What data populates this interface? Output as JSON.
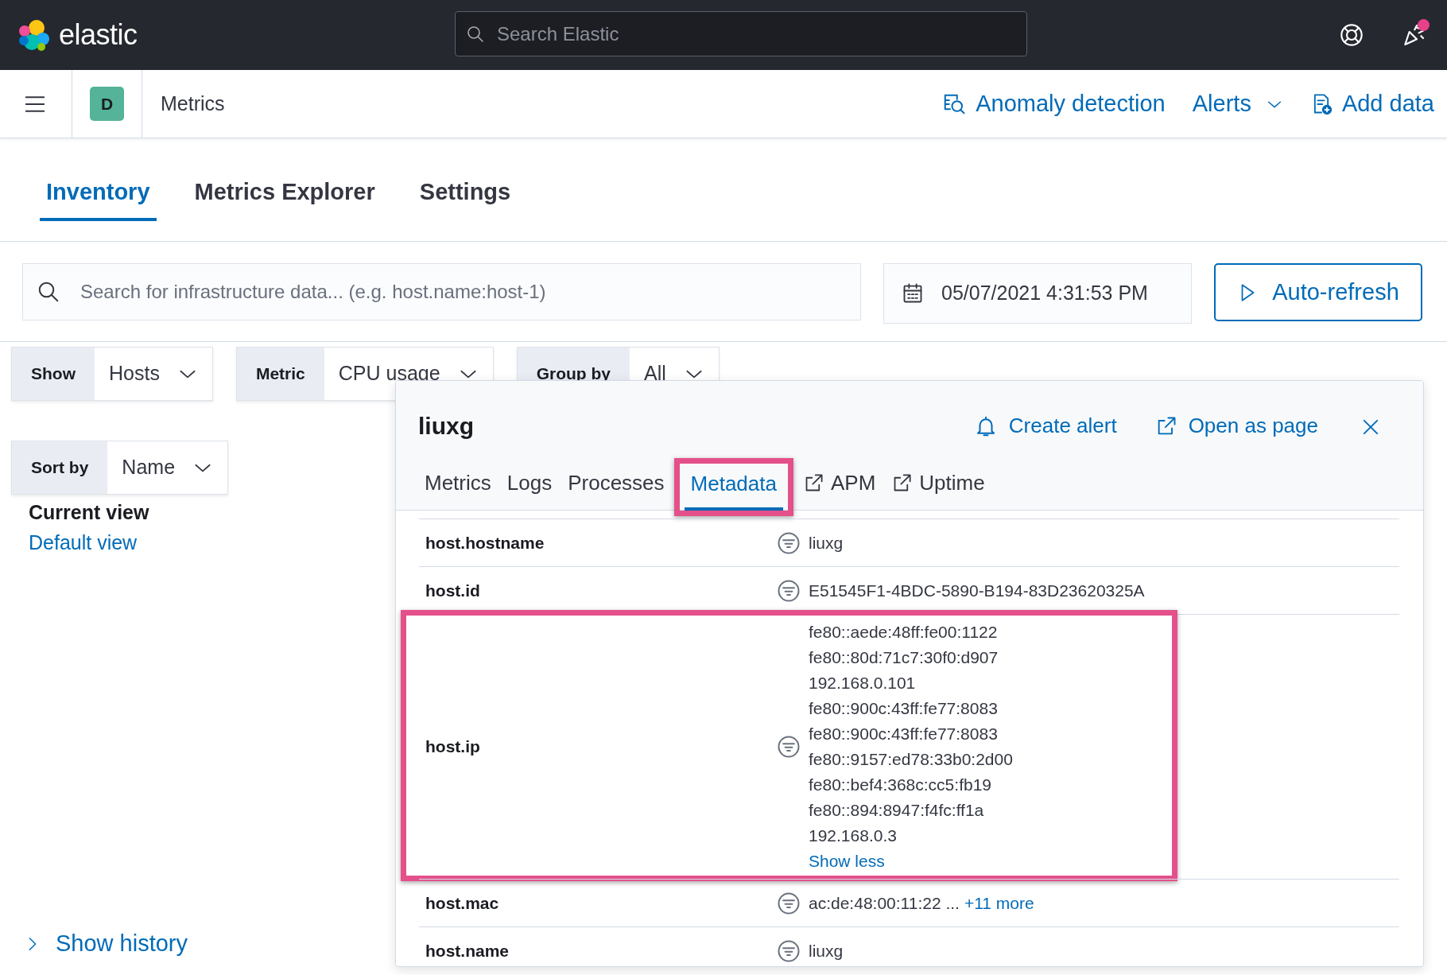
{
  "header": {
    "brand": "elastic",
    "search_placeholder": "Search Elastic",
    "notification": true
  },
  "app_bar": {
    "space_initial": "D",
    "title": "Metrics",
    "links": [
      {
        "label": "Anomaly detection",
        "kind": "anomaly"
      },
      {
        "label": "Alerts",
        "kind": "dropdown"
      },
      {
        "label": "Add data",
        "kind": "add"
      }
    ]
  },
  "tabs": [
    {
      "label": "Inventory",
      "selected": true
    },
    {
      "label": "Metrics Explorer",
      "selected": false
    },
    {
      "label": "Settings",
      "selected": false
    }
  ],
  "query_bar": {
    "placeholder": "Search for infrastructure data... (e.g. host.name:host-1)",
    "date": "05/07/2021 4:31:53 PM",
    "refresh_button": "Auto-refresh"
  },
  "filters": [
    {
      "label": "Show",
      "value": "Hosts"
    },
    {
      "label": "Metric",
      "value": "CPU usage"
    },
    {
      "label": "Group by",
      "value": "All"
    }
  ],
  "sort": {
    "label": "Sort by",
    "value": "Name"
  },
  "saved_view": {
    "heading": "Current view",
    "link": "Default view"
  },
  "show_history": "Show history",
  "flyout": {
    "title": "liuxg",
    "actions": [
      {
        "label": "Create alert",
        "kind": "bell"
      },
      {
        "label": "Open as page",
        "kind": "external"
      }
    ],
    "tabs": [
      {
        "label": "Metrics",
        "selected": false,
        "external": false,
        "highlighted": false
      },
      {
        "label": "Logs",
        "selected": false,
        "external": false,
        "highlighted": false
      },
      {
        "label": "Processes",
        "selected": false,
        "external": false,
        "highlighted": false
      },
      {
        "label": "Metadata",
        "selected": true,
        "external": false,
        "highlighted": true
      },
      {
        "label": "APM",
        "selected": false,
        "external": true,
        "highlighted": false
      },
      {
        "label": "Uptime",
        "selected": false,
        "external": true,
        "highlighted": false
      }
    ],
    "rows": [
      {
        "field": "host.hostname",
        "values": [
          "liuxg"
        ],
        "highlighted": false
      },
      {
        "field": "host.id",
        "values": [
          "E51545F1-4BDC-5890-B194-83D23620325A"
        ],
        "highlighted": false
      },
      {
        "field": "host.ip",
        "values": [
          "fe80::aede:48ff:fe00:1122",
          "fe80::80d:71c7:30f0:d907",
          "192.168.0.101",
          "fe80::900c:43ff:fe77:8083",
          "fe80::900c:43ff:fe77:8083",
          "fe80::9157:ed78:33b0:2d00",
          "fe80::bef4:368c:cc5:fb19",
          "fe80::894:8947:f4fc:ff1a",
          "192.168.0.3"
        ],
        "link": "Show less",
        "highlighted": true
      },
      {
        "field": "host.mac",
        "values": [
          "ac:de:48:00:11:22 ..."
        ],
        "link": "+11 more",
        "highlighted": false
      },
      {
        "field": "host.name",
        "values": [
          "liuxg"
        ],
        "highlighted": false
      }
    ]
  }
}
